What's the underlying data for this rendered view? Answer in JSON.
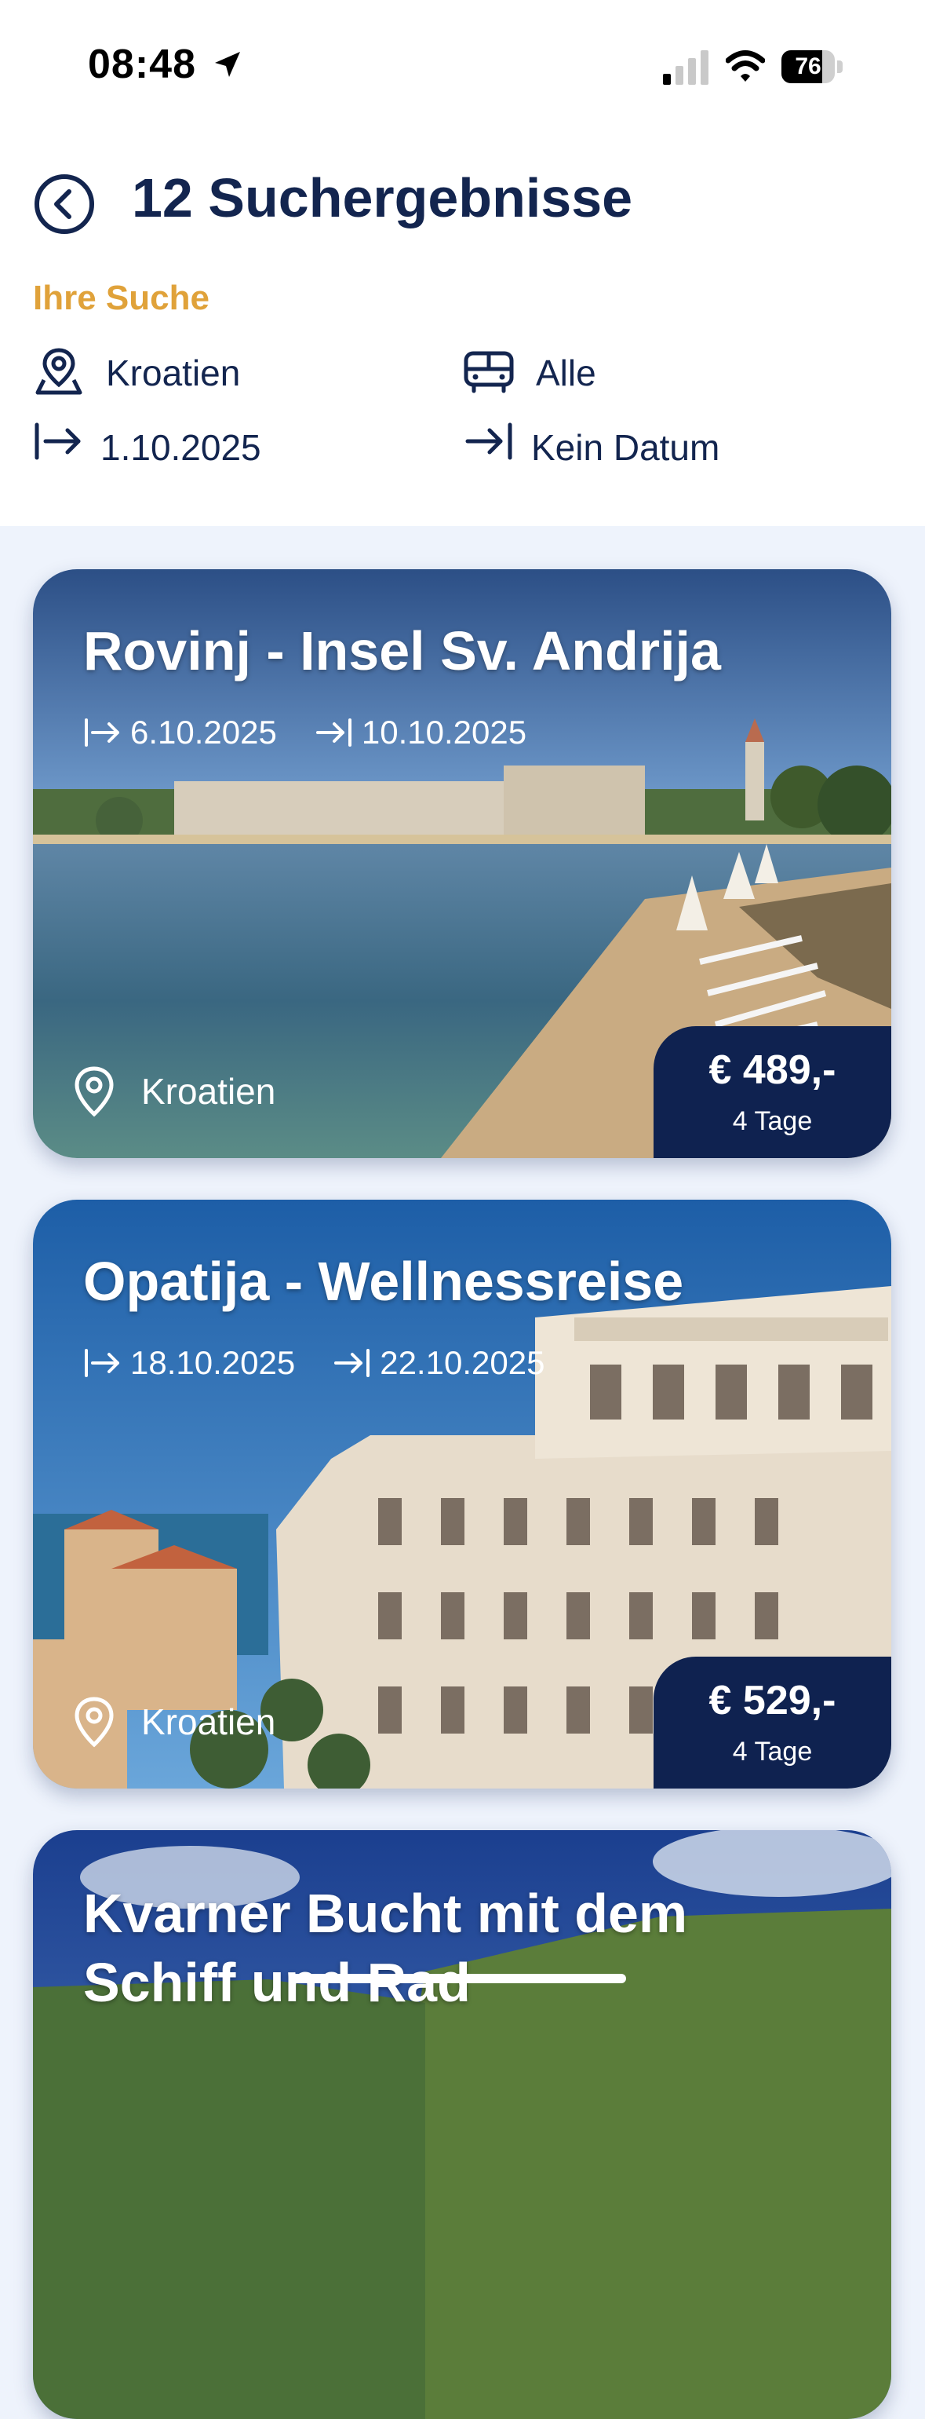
{
  "status": {
    "time": "08:48",
    "battery": "76"
  },
  "header": {
    "title": "12 Suchergebnisse",
    "search_label": "Ihre Suche",
    "criteria": {
      "destination": "Kroatien",
      "transport": "Alle",
      "start_date": "1.10.2025",
      "end_date": "Kein Datum"
    }
  },
  "results": [
    {
      "title": "Rovinj - Insel Sv. Andrija",
      "start": "6.10.2025",
      "end": "10.10.2025",
      "location": "Kroatien",
      "price": "€ 489,-",
      "duration": "4 Tage"
    },
    {
      "title": "Opatija - Wellnessreise",
      "start": "18.10.2025",
      "end": "22.10.2025",
      "location": "Kroatien",
      "price": "€ 529,-",
      "duration": "4 Tage"
    },
    {
      "title": "Kvarner Bucht mit dem Schiff und Rad"
    }
  ],
  "icons": {
    "back": "back-circle-icon",
    "destination": "map-pin-person-icon",
    "transport": "bus-icon",
    "start": "arrow-right-from-bar-icon",
    "end": "arrow-right-to-bar-icon",
    "location": "map-pin-icon"
  },
  "colors": {
    "navy": "#13254f",
    "accent": "#e0a23a",
    "price_bg": "#0f2250",
    "page_bg": "#eef3fc"
  }
}
